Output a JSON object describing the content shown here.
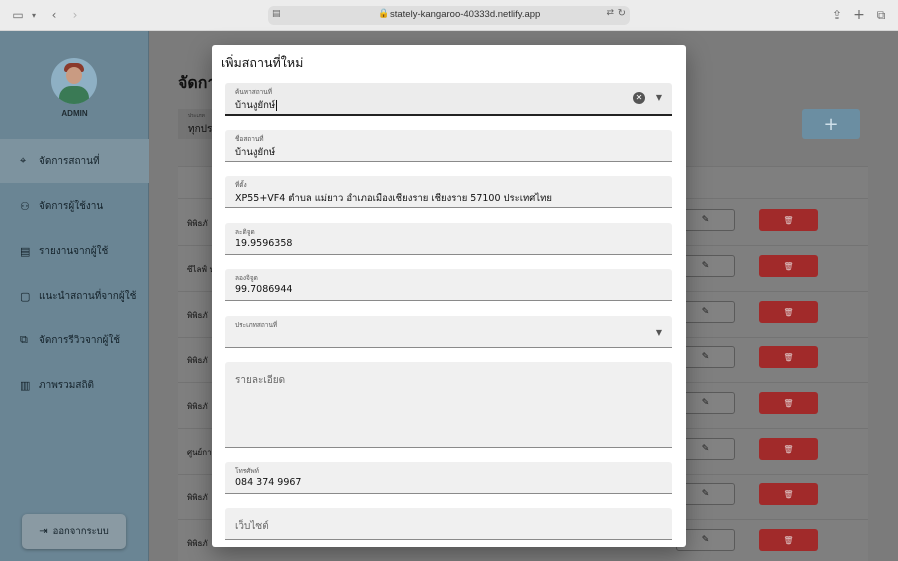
{
  "browser": {
    "url": "stately-kangaroo-40333d.netlify.app"
  },
  "sidebar": {
    "user_label": "ADMIN",
    "items": [
      {
        "label": "จัดการสถานที่",
        "icon": "map-pin-icon",
        "active": true
      },
      {
        "label": "จัดการผู้ใช้งาน",
        "icon": "user-gear-icon",
        "active": false
      },
      {
        "label": "รายงานจากผู้ใช้",
        "icon": "clipboard-icon",
        "active": false
      },
      {
        "label": "แนะนำสถานที่จากผู้ใช้",
        "icon": "chat-icon",
        "active": false
      },
      {
        "label": "จัดการรีวิวจากผู้ใช้",
        "icon": "reviews-icon",
        "active": false
      },
      {
        "label": "ภาพรวมสถิติ",
        "icon": "bar-chart-icon",
        "active": false
      }
    ],
    "logout_label": "ออกจากระบบ"
  },
  "main": {
    "title": "จัดกา",
    "filter": {
      "label": "ประเภท",
      "value": "ทุกปร"
    },
    "add_label": "+",
    "rows": [
      {
        "name": "พิพิธภั"
      },
      {
        "name": "ซีไลฟ์ บ"
      },
      {
        "name": "พิพิธภั"
      },
      {
        "name": "พิพิธภั"
      },
      {
        "name": "พิพิธภั"
      },
      {
        "name": "ศูนย์กา"
      },
      {
        "name": "พิพิธภั"
      },
      {
        "name": "พิพิธภั"
      }
    ]
  },
  "modal": {
    "title": "เพิ่มสถานที่ใหม่",
    "fields": {
      "search": {
        "label": "ค้นหาสถานที่",
        "value": "บ้านงูยักษ์"
      },
      "name": {
        "label": "ชื่อสถานที่",
        "value": "บ้านงูยักษ์"
      },
      "address": {
        "label": "ที่ตั้ง",
        "value": "XP55+VF4 ตำบล แม่ยาว อำเภอเมืองเชียงราย เชียงราย 57100 ประเทศไทย"
      },
      "latitude": {
        "label": "ละติจูด",
        "value": "19.9596358"
      },
      "longitude": {
        "label": "ลองจิจูด",
        "value": "99.7086944"
      },
      "type": {
        "label": "ประเภทสถานที่",
        "value": ""
      },
      "details": {
        "placeholder": "รายละเอียด"
      },
      "phone": {
        "label": "โทรศัพท์",
        "value": "084 374 9967"
      },
      "website": {
        "placeholder": "เว็บไซต์"
      }
    }
  }
}
